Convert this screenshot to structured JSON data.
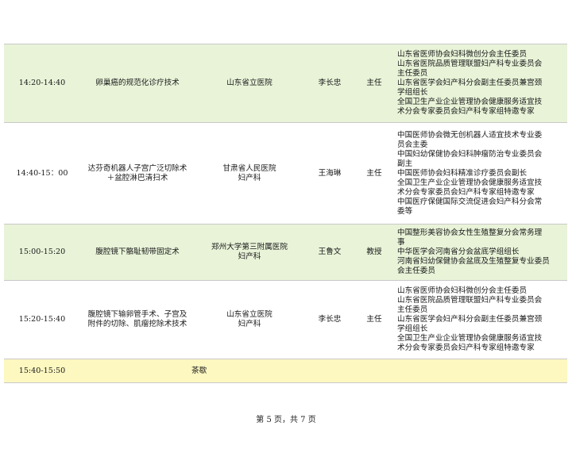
{
  "rows": [
    {
      "time": "14:20-14:40",
      "topic": [
        "卵巢癌的规范化诊疗技术"
      ],
      "org": [
        "山东省立医院"
      ],
      "speaker": "李长忠",
      "title": "主任",
      "roles": [
        "山东省医师协会妇科微创分会主任委员",
        "山东省医院品质管理联盟妇产科专业委员会",
        "主任委员",
        "山东省医学会妇产科分会副主任委员兼宫颈",
        "学组组长",
        "全国卫生产业企业管理协会健康服务适宜技",
        "术分会专家委员会妇产科专家组特邀专家"
      ]
    },
    {
      "time": "14:40-15：00",
      "topic": [
        "达芬奇机器人子宫广泛切除术",
        "＋盆腔淋巴清扫术"
      ],
      "org": [
        "甘肃省人民医院",
        "妇产科"
      ],
      "speaker": "王海琳",
      "title": "主任",
      "roles": [
        "中国医师协会微无创机器人适宜技术专业委",
        "员会主委",
        "中国妇幼保健协会妇科肿瘤防治专业委员会",
        "副主",
        "中国医师协会妇科精准诊疗委员会副长",
        "全国卫生产业企业管理协会健康服务适宜技",
        "术分会专家委员会妇产科专家组特邀专家",
        "中国医疗保健国际交流促进会妇产科分会常",
        "委等"
      ]
    },
    {
      "time": "15:00-15:20",
      "topic": [
        "腹腔镜下骼耻韧带固定术"
      ],
      "org": [
        "郑州大学第三附属医院",
        "妇产科"
      ],
      "speaker": "王鲁文",
      "title": "教授",
      "roles": [
        "中国整形美容协会女性生殖整复分会常务理",
        "事",
        "中华医学会河南省分会盆底学组组长",
        "河南省妇幼保健协会盆底及生殖整复专业委员",
        "会主任委员"
      ]
    },
    {
      "time": "15:20-15:40",
      "topic": [
        "腹腔镜下输卵管手术、子宫及",
        "附件的切除、肌瘤挖除术技术"
      ],
      "org": [
        "山东省立医院",
        "妇产科"
      ],
      "speaker": "李长忠",
      "title": "主任",
      "roles": [
        "山东省医师协会妇科微创分会主任委员",
        "山东省医院品质管理联盟妇产科专业委员会",
        "主任委员",
        "山东省医学会妇产科分会副主任委员兼宫颈",
        "学组组长",
        "全国卫生产业企业管理协会健康服务适宜技",
        "术分会专家委员会妇产科专家组特邀专家"
      ]
    }
  ],
  "break_row": {
    "time": "15:40-15:50",
    "label": "茶歇"
  },
  "footer": "第 5 页，共 7 页",
  "colors": {
    "green_row": "#e8f3d8",
    "break_row": "#fdf7c0",
    "border": "#c9c9c9"
  }
}
